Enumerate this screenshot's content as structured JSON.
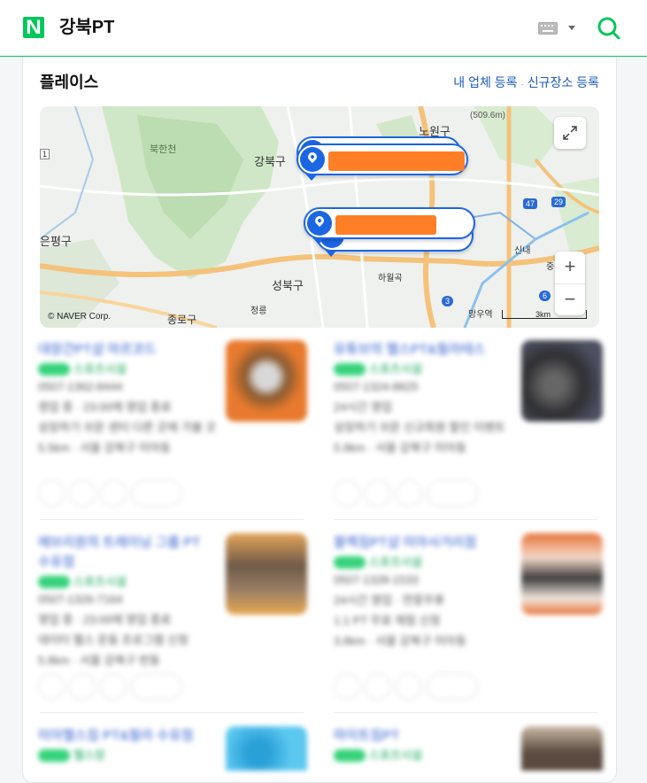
{
  "header": {
    "logo_text": "N",
    "query": "강북PT",
    "logo_color": "#03c75a"
  },
  "place": {
    "title": "플레이스",
    "link_register_business": "내 업체 등록",
    "link_separator": "·",
    "link_register_new_place": "신규장소 등록"
  },
  "map": {
    "labels": {
      "bukhansan": "북한천",
      "gangbuk": "강북구",
      "nowon": "노원구",
      "eunpyeong": "은평구",
      "seongbuk": "성북구",
      "jongno": "종로구",
      "jeongneung": "정릉",
      "hawolgok": "하월곡",
      "sinnae": "신내",
      "mangu": "망우역",
      "peak": "(509.6m)",
      "junggu": "중",
      "route_47": "47",
      "route_29": "29",
      "route_3": "3",
      "route_6": "6",
      "route_1": "1"
    },
    "copyright": "© NAVER Corp.",
    "scale": "3km",
    "zoom_in": "+",
    "zoom_out": "−",
    "pin_color": "#1b66e2",
    "redact_color": "#ff7f26"
  },
  "listings": [
    {
      "title": "대장간PT샵 마르코드",
      "sub": "스포츠시설",
      "lines": [
        "0507-1362-8444",
        "영업 중 · 23:00에 영업 종료",
        "성장하기 쉬운 센터 다른 곳에 가볼 곳",
        "5.5km · 서울 강북구 미아동"
      ]
    },
    {
      "title": "유튜브의 헬스PT&필라테스",
      "sub": "스포츠시설",
      "lines": [
        "0507-1324-8825",
        "24시간 영업",
        "성장하기 쉬운 신규회원 할인 이벤트",
        "5.9km · 서울 강북구 미아동"
      ]
    },
    {
      "title": "에브리원의 트레이닝 그룹 PT 수유점",
      "sub": "스포츠시설",
      "lines": [
        "0507-1326-7164",
        "영업 중 · 23:00에 영업 종료",
        "데이터 헬스 운동 프로그램 신청",
        "5.8km · 서울 강북구 번동"
      ]
    },
    {
      "title": "블랙짐PT샵 미아사거리점",
      "sub": "스포츠시설",
      "lines": [
        "0507-1328-1533",
        "24시간 영업 · 연중무휴",
        "1:1 PT 무료 체험 신청",
        "3.8km · 서울 강북구 미아동"
      ]
    },
    {
      "title": "미아헬스짐 PT&필라 수유점",
      "sub": "헬스장",
      "lines": []
    },
    {
      "title": "마이트짐PT",
      "sub": "스포츠시설",
      "lines": []
    }
  ]
}
